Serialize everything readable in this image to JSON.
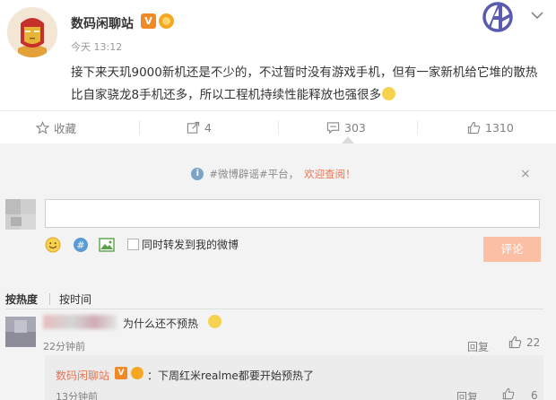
{
  "post": {
    "author": "数码闲聊站",
    "verified_badge": "V",
    "timestamp": "今天 13:12",
    "text": "接下来天玑9000新机还是不少的，不过暂时没有游戏手机，但有一家新机给它堆的散热比自家骁龙8手机还多，所以工程机持续性能释放也强很多"
  },
  "actions": {
    "favorite": "收藏",
    "repost_count": "4",
    "comment_count": "303",
    "like_count": "1310"
  },
  "comment_panel": {
    "notice_topic": "#微博辟谣#平台，",
    "notice_welcome": "欢迎查阅！",
    "notice_close": "×",
    "input_value": "",
    "repost_label": "同时转发到我的微博",
    "submit_label": "评论",
    "sort_hot": "按热度",
    "sort_time": "按时间"
  },
  "comments": [
    {
      "text": "为什么还不预热",
      "time": "22分钟前",
      "reply_label": "回复",
      "likes": "22",
      "replies": [
        {
          "author": "数码闲聊站",
          "badge": "V",
          "text": "：下周红米realme都要开始预热了",
          "time": "13分钟前",
          "reply_label": "回复",
          "likes": "6"
        }
      ]
    }
  ],
  "colors": {
    "accent": "#eb7350",
    "submit_disabled": "#fbbfa4",
    "badge_orange": "#f08a24",
    "panel_bg": "#f3f3f3"
  },
  "icons": [
    "avatar-ironman",
    "avengers-logo-icon",
    "chevron-down-icon",
    "star-icon",
    "repost-icon",
    "comment-icon",
    "like-icon",
    "info-icon",
    "emoji-icon",
    "topic-icon",
    "image-icon"
  ]
}
